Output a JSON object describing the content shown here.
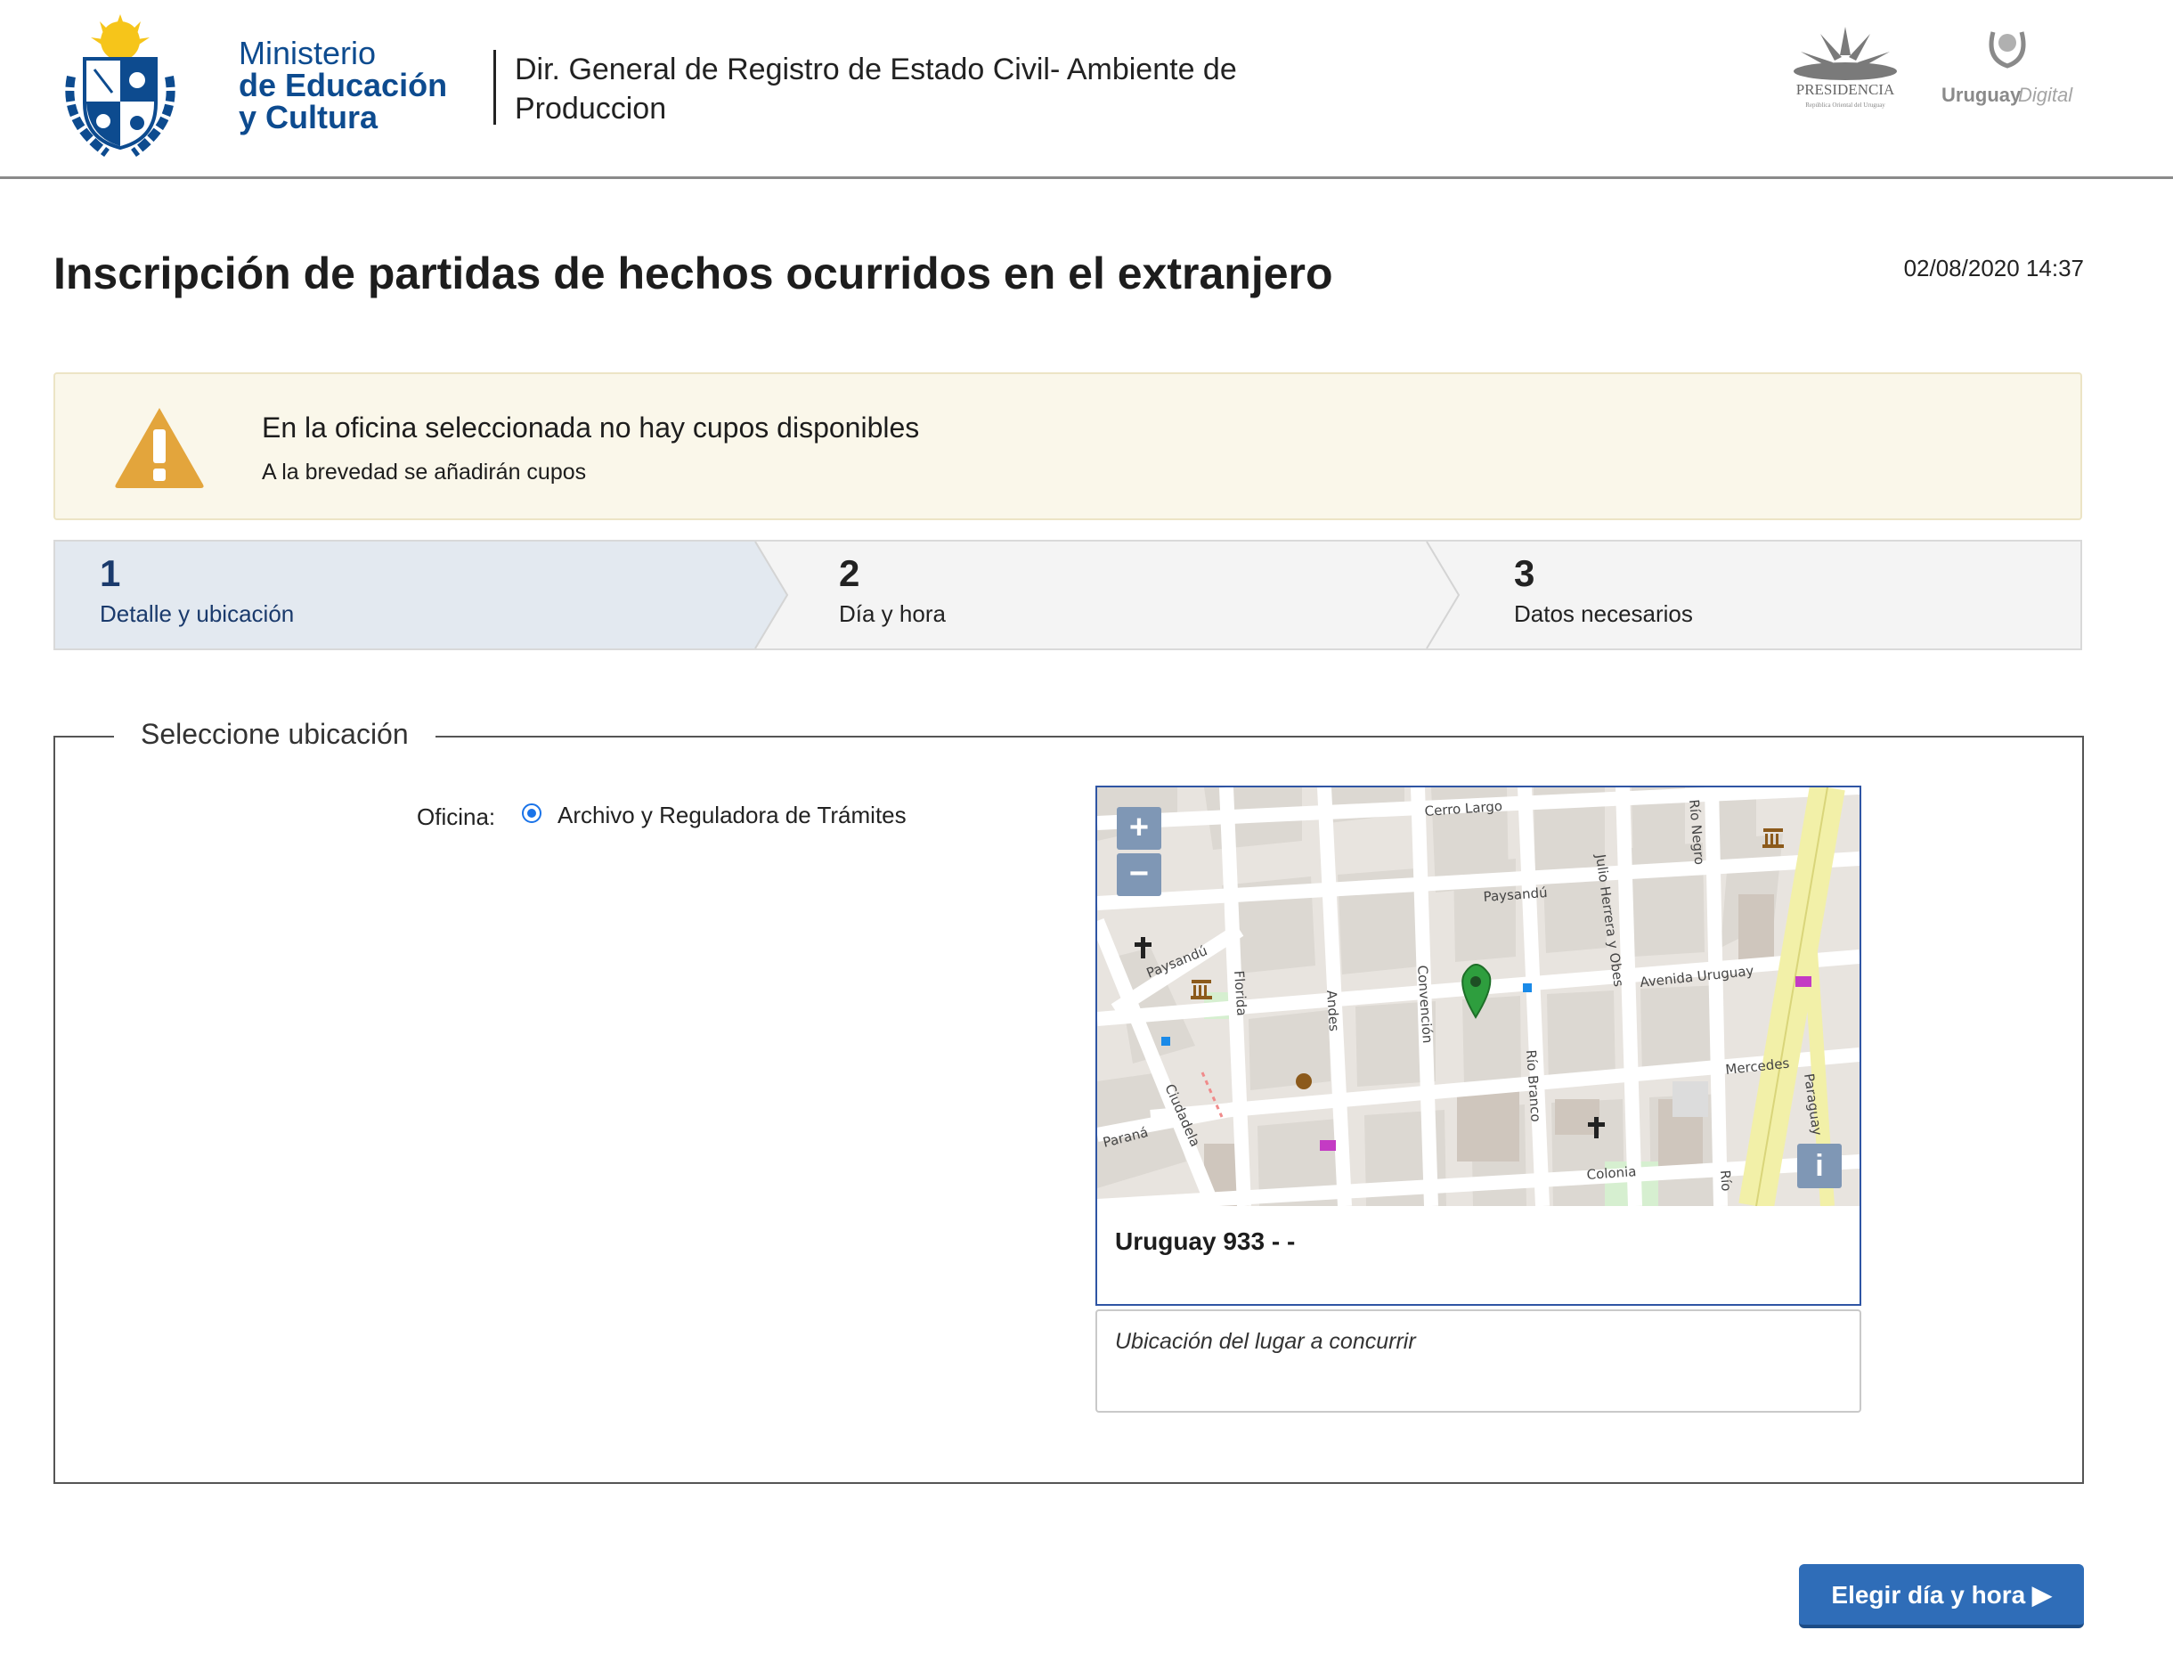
{
  "header": {
    "ministry_line1": "Ministerio",
    "ministry_line2": "de Educación",
    "ministry_line3": "y Cultura",
    "title": "Dir. General de Registro de Estado Civil- Ambiente de Produccion",
    "presidencia_label": "PRESIDENCIA",
    "presidencia_sub": "República Oriental del Uruguay",
    "uruguay_label": "Uruguay",
    "digital_label": "Digital"
  },
  "page": {
    "title": "Inscripción de partidas de hechos ocurridos en el extranjero",
    "datetime": "02/08/2020 14:37"
  },
  "alert": {
    "icon": "warning-icon",
    "title": "En la oficina seleccionada no hay cupos disponibles",
    "subtitle": "A la brevedad se añadirán cupos"
  },
  "steps": [
    {
      "number": "1",
      "label": "Detalle y ubicación",
      "active": true
    },
    {
      "number": "2",
      "label": "Día y hora",
      "active": false
    },
    {
      "number": "3",
      "label": "Datos necesarios",
      "active": false
    }
  ],
  "location": {
    "legend": "Seleccione ubicación",
    "office_label": "Oficina:",
    "office_option": "Archivo y Reguladora de Trámites",
    "address": "Uruguay 933 - -",
    "input_placeholder": "Ubicación del lugar a concurrir",
    "map": {
      "zoom_in": "+",
      "zoom_out": "−",
      "info": "i",
      "streets": [
        "Cerro Largo",
        "Río Negro",
        "Paysandú",
        "Paysandú",
        "Julio Herrera y Obes",
        "Avenida Uruguay",
        "Florida",
        "Andes",
        "Convención",
        "Río Branco",
        "Mercedes",
        "Ciudadela",
        "Paraná",
        "Colonia",
        "Paraguay",
        "Río"
      ]
    }
  },
  "actions": {
    "next_label": "Elegir día y hora ▶"
  },
  "colors": {
    "ministry_blue": "#0d4b8f",
    "step_active_bg": "#e3e9f0",
    "step_active_text": "#1a3a6c",
    "alert_bg": "#faf7ea",
    "warning": "#e3a53c",
    "primary_button": "#2f6db8",
    "map_border": "#2f55a4",
    "marker": "#2e9e3e"
  }
}
